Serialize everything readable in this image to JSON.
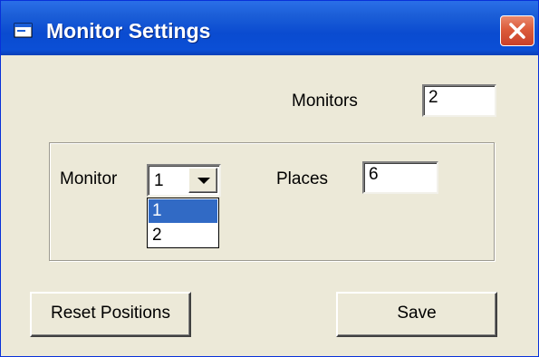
{
  "window": {
    "title": "Monitor Settings"
  },
  "monitors": {
    "label": "Monitors",
    "value": "2"
  },
  "group": {
    "monitor_label": "Monitor",
    "monitor_selected": "1",
    "monitor_options": [
      "1",
      "2"
    ],
    "places_label": "Places",
    "places_value": "6"
  },
  "buttons": {
    "reset_label": "Reset Positions",
    "save_label": "Save"
  },
  "colors": {
    "titlebar": "#0a4bd0",
    "dialog_bg": "#ece9d8",
    "selection": "#316ac5",
    "close_button": "#dc5b3a"
  },
  "icons": {
    "app": "window-icon",
    "close": "close-icon",
    "dropdown": "chevron-down-icon"
  }
}
